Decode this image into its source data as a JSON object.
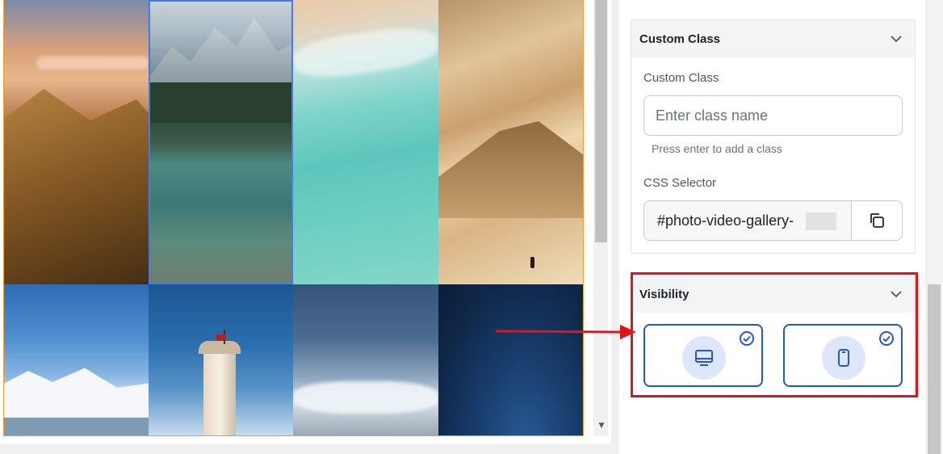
{
  "gallery": {
    "tiles": [
      {
        "subject": "mountain sunset"
      },
      {
        "subject": "alpine lake"
      },
      {
        "subject": "aerial beach"
      },
      {
        "subject": "sand dunes"
      },
      {
        "subject": "snowy mountains"
      },
      {
        "subject": "lighthouse"
      },
      {
        "subject": "clouds over plain"
      },
      {
        "subject": "night sky"
      }
    ]
  },
  "custom_class_section": {
    "title": "Custom Class",
    "field_label": "Custom Class",
    "input_placeholder": "Enter class name",
    "input_value": "",
    "hint": "Press enter to add a class",
    "css_selector_label": "CSS Selector",
    "css_selector_value": "#photo-video-gallery-"
  },
  "visibility_section": {
    "title": "Visibility",
    "options": [
      {
        "device": "desktop",
        "icon": "desktop-icon",
        "checked": true
      },
      {
        "device": "mobile",
        "icon": "mobile-icon",
        "checked": true
      }
    ]
  },
  "colors": {
    "accent": "#2358c9",
    "highlight": "#e0141b",
    "icon_bg": "#dde6fb"
  }
}
